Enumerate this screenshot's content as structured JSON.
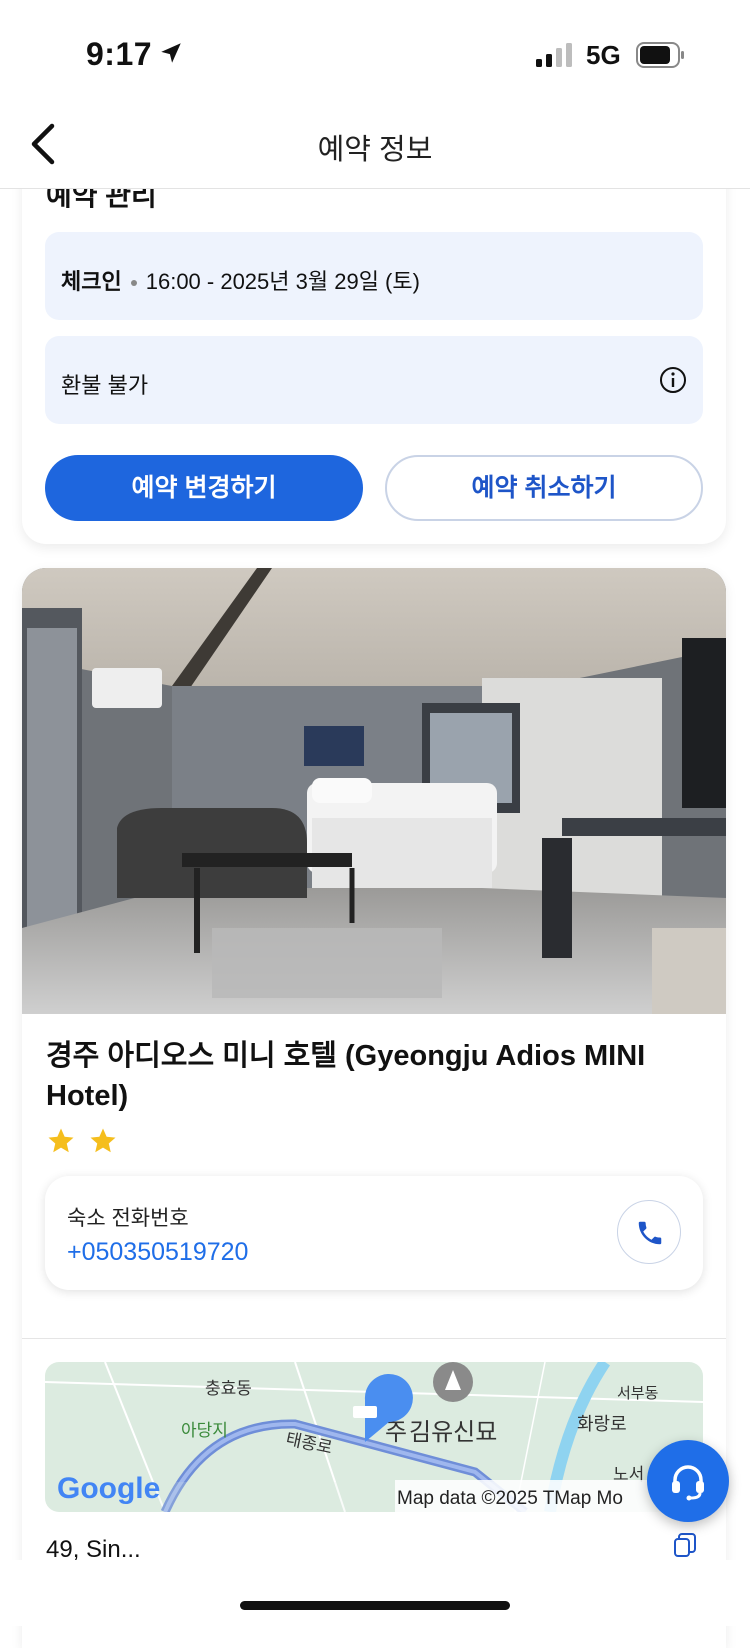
{
  "status_bar": {
    "time": "9:17",
    "network": "5G"
  },
  "nav": {
    "title": "예약 정보"
  },
  "manage": {
    "section_title": "예약 관리",
    "checkin_label": "체크인",
    "checkin_value": "16:00 - 2025년 3월 29일 (토)",
    "refund_label": "환불 불가",
    "change_button": "예약 변경하기",
    "cancel_button": "예약 취소하기"
  },
  "hotel": {
    "name": "경주 아디오스 미니 호텔 (Gyeongju Adios MINI Hotel)",
    "star_rating": 2,
    "phone_label": "숙소 전화번호",
    "phone_number": "+050350519720",
    "address_partial": "49, Sin..."
  },
  "map": {
    "labels": {
      "chunghyo": "충효동",
      "adangji": "아당지",
      "taejongro": "태종로",
      "kimyushin": "김유신묘",
      "seobu": "서부동",
      "hwarang": "화랑로",
      "noseo": "노서",
      "ju": "주"
    },
    "attribution": "Map data ©2025 TMap Mo",
    "logo_text": "Google"
  },
  "colors": {
    "accent": "#1e66de",
    "info_bg": "#eef3fd",
    "link": "#1f6ee8",
    "star": "#f5be1d"
  },
  "icons": [
    "location-arrow-icon",
    "signal-icon",
    "battery-icon",
    "back-chevron-icon",
    "info-icon",
    "star-icon",
    "phone-icon",
    "copy-icon",
    "headset-icon"
  ]
}
